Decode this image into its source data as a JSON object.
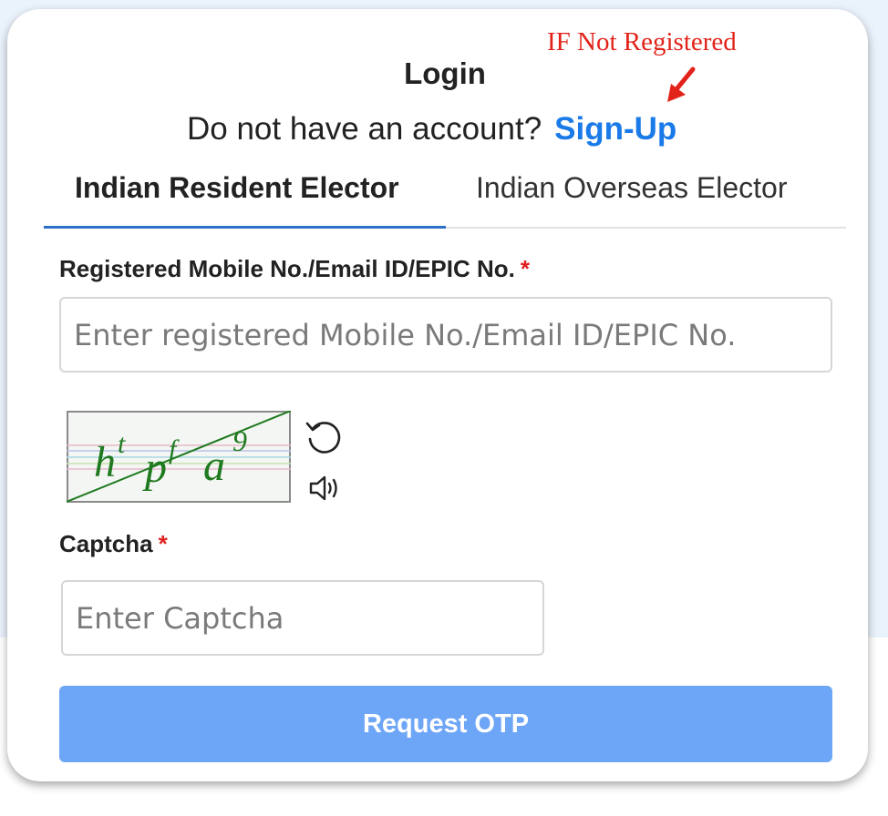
{
  "annotation": {
    "text": "IF Not Registered",
    "color": "#e2231a"
  },
  "login": {
    "title": "Login",
    "signup_prompt": "Do not have an account?",
    "signup_link": "Sign-Up"
  },
  "tabs": [
    {
      "label": "Indian Resident Elector",
      "active": true
    },
    {
      "label": "Indian Overseas Elector",
      "active": false
    }
  ],
  "form": {
    "id_label": "Registered Mobile No./Email ID/EPIC No.",
    "required_mark": "*",
    "id_placeholder": "Enter registered Mobile No./Email ID/EPIC No.",
    "id_value": "",
    "captcha_text": "htpfa9",
    "captcha_chars": [
      "h",
      "t",
      "p",
      "f",
      "a",
      "9"
    ],
    "captcha_label": "Captcha",
    "captcha_placeholder": "Enter Captcha",
    "captcha_value": "",
    "refresh_icon": "refresh-icon",
    "audio_icon": "speaker-icon"
  },
  "actions": {
    "request_otp_label": "Request OTP"
  },
  "colors": {
    "accent": "#1a7ae8",
    "button": "#6ea6f7",
    "tab_underline": "#2a6fc9",
    "required": "#e02020",
    "captcha_text": "#1f7a1f"
  }
}
